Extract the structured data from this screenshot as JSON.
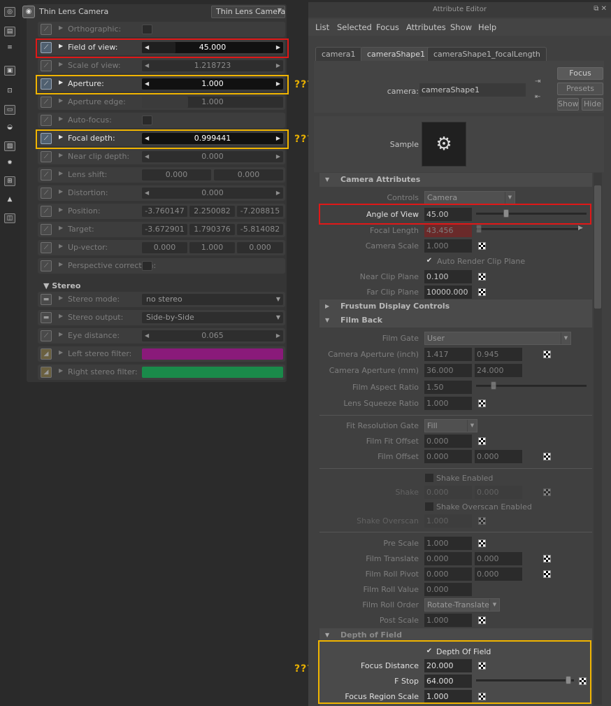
{
  "toolbar": {
    "icons": [
      "camera-tool-icon",
      "layers-icon",
      "stack-icon",
      "image-icon",
      "frame-icon",
      "monitor-icon",
      "database-icon",
      "picture-icon",
      "light-icon",
      "shader-icon",
      "paint-icon",
      "cube-icon"
    ]
  },
  "left_panel": {
    "title": "Thin Lens Camera",
    "combo": "Thin Lens Camera",
    "rows": [
      {
        "label": "Orthographic:"
      },
      {
        "label": "Field of view:",
        "value": "45.000"
      },
      {
        "label": "Scale of view:",
        "value": "1.218723"
      },
      {
        "label": "Aperture:",
        "value": "1.000"
      },
      {
        "label": "Aperture edge:",
        "value": "1.000"
      },
      {
        "label": "Auto-focus:"
      },
      {
        "label": "Focal depth:",
        "value": "0.999441"
      },
      {
        "label": "Near clip depth:",
        "value": "0.000"
      },
      {
        "label": "Lens shift:",
        "v1": "0.000",
        "v2": "0.000"
      },
      {
        "label": "Distortion:",
        "value": "0.000"
      },
      {
        "label": "Position:",
        "v1": "-3.760147",
        "v2": "2.250082",
        "v3": "-7.208815"
      },
      {
        "label": "Target:",
        "v1": "-3.672901",
        "v2": "1.790376",
        "v3": "-5.814082"
      },
      {
        "label": "Up-vector:",
        "v1": "0.000",
        "v2": "1.000",
        "v3": "0.000"
      },
      {
        "label": "Perspective correction:"
      }
    ],
    "stereo_header": "Stereo",
    "stereo_rows": [
      {
        "label": "Stereo mode:",
        "value": "no stereo"
      },
      {
        "label": "Stereo output:",
        "value": "Side-by-Side"
      },
      {
        "label": "Eye distance:",
        "value": "0.065"
      },
      {
        "label": "Left stereo filter:",
        "color": "#8a1a7a"
      },
      {
        "label": "Right stereo filter:",
        "color": "#1a8a4a"
      }
    ]
  },
  "annotations": {
    "q1": "???",
    "q2": "???",
    "q3": "???",
    "red": "#e01818",
    "yellow": "#f0b400"
  },
  "attr_editor": {
    "title": "Attribute Editor",
    "menu": [
      "List",
      "Selected",
      "Focus",
      "Attributes",
      "Show",
      "Help"
    ],
    "tabs": [
      "camera1",
      "cameraShape1",
      "cameraShape1_focalLength"
    ],
    "camera_label": "camera:",
    "camera_value": "cameraShape1",
    "buttons": {
      "focus": "Focus",
      "presets": "Presets",
      "show": "Show",
      "hide": "Hide"
    },
    "sample_label": "Sample",
    "sections": {
      "camera_attributes": "Camera Attributes",
      "frustum": "Frustum Display Controls",
      "film_back": "Film Back",
      "dof": "Depth of Field"
    },
    "camera_attrs": {
      "controls_label": "Controls",
      "controls_value": "Camera",
      "angle_label": "Angle of View",
      "angle_value": "45.00",
      "focal_label": "Focal Length",
      "focal_value": "43.456",
      "scale_label": "Camera Scale",
      "scale_value": "1.000",
      "auto_clip": "Auto Render Clip Plane",
      "near_label": "Near Clip Plane",
      "near_value": "0.100",
      "far_label": "Far Clip Plane",
      "far_value": "10000.000"
    },
    "film_back": {
      "gate_label": "Film Gate",
      "gate_value": "User",
      "ap_inch_label": "Camera Aperture (inch)",
      "ap_inch_1": "1.417",
      "ap_inch_2": "0.945",
      "ap_mm_label": "Camera Aperture (mm)",
      "ap_mm_1": "36.000",
      "ap_mm_2": "24.000",
      "aspect_label": "Film Aspect Ratio",
      "aspect_value": "1.50",
      "squeeze_label": "Lens Squeeze Ratio",
      "squeeze_value": "1.000",
      "fitgate_label": "Fit Resolution Gate",
      "fitgate_value": "Fill",
      "fitoff_label": "Film Fit Offset",
      "fitoff_value": "0.000",
      "filmoff_label": "Film Offset",
      "filmoff_1": "0.000",
      "filmoff_2": "0.000",
      "shake_enabled": "Shake Enabled",
      "shake_label": "Shake",
      "shake_1": "0.000",
      "shake_2": "0.000",
      "shake_os_enabled": "Shake Overscan Enabled",
      "shake_os_label": "Shake Overscan",
      "shake_os_value": "1.000",
      "prescale_label": "Pre Scale",
      "prescale_value": "1.000",
      "translate_label": "Film Translate",
      "translate_1": "0.000",
      "translate_2": "0.000",
      "pivot_label": "Film Roll Pivot",
      "pivot_1": "0.000",
      "pivot_2": "0.000",
      "rollval_label": "Film Roll Value",
      "rollval_value": "0.000",
      "rollorder_label": "Film Roll Order",
      "rollorder_value": "Rotate-Translate",
      "postscale_label": "Post Scale",
      "postscale_value": "1.000"
    },
    "dof": {
      "enabled": "Depth Of Field",
      "focus_dist_label": "Focus Distance",
      "focus_dist_value": "20.000",
      "fstop_label": "F Stop",
      "fstop_value": "64.000",
      "region_label": "Focus Region Scale",
      "region_value": "1.000"
    }
  }
}
